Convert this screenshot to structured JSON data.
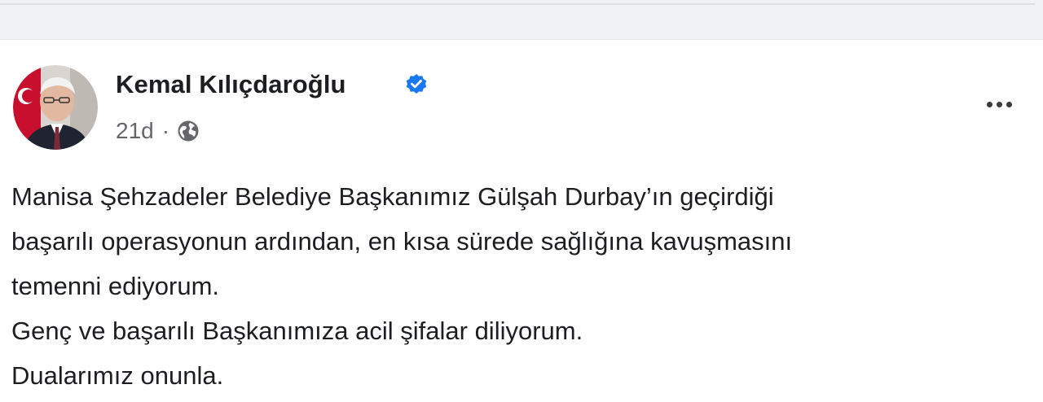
{
  "post": {
    "author": "Kemal Kılıçdaroğlu",
    "verified_icon": "verified-badge-icon",
    "time": "21d",
    "separator": "·",
    "privacy_icon": "globe-icon",
    "more_icon": "more-options-icon",
    "text_lines": [
      "Manisa Şehzadeler Belediye Başkanımız Gülşah Durbay’ın geçirdiği",
      "başarılı operasyonun ardından, en kısa sürede sağlığına kavuşmasını",
      "temenni ediyorum.",
      "Genç ve başarılı Başkanımıza acil şifalar diliyorum.",
      "Dualarımız onunla."
    ]
  },
  "colors": {
    "page_background": "#f0f2f5",
    "card_background": "#ffffff",
    "text_primary": "#1c1e21",
    "text_secondary": "#65676b",
    "verified_blue": "#1877f2"
  }
}
